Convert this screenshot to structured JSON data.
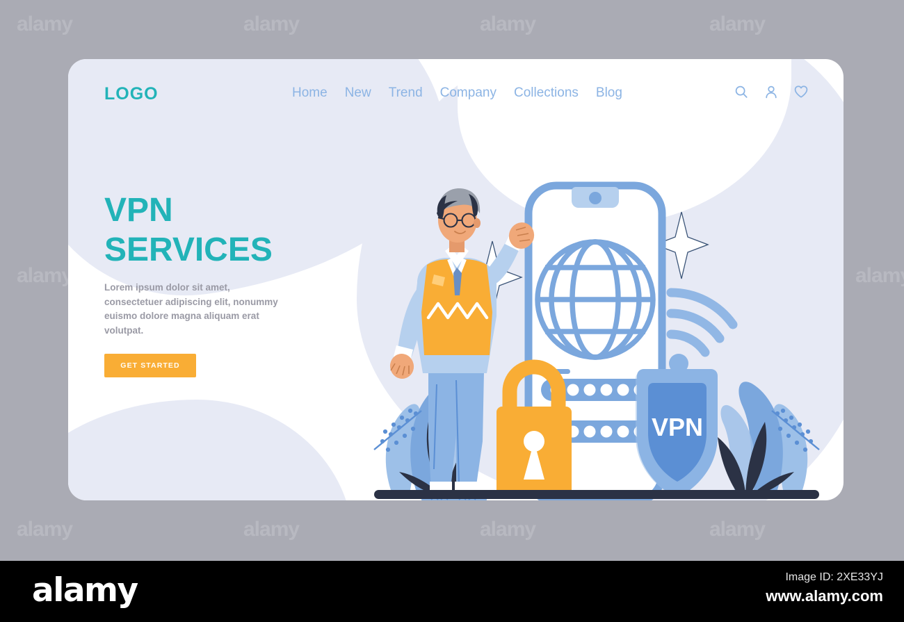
{
  "stock": {
    "watermark_text": "alamy",
    "footer_logo": "alamy",
    "image_id": "Image ID: 2XE33YJ",
    "url": "www.alamy.com"
  },
  "header": {
    "logo": "LOGO",
    "nav": [
      {
        "label": "Home"
      },
      {
        "label": "New"
      },
      {
        "label": "Trend"
      },
      {
        "label": "Company"
      },
      {
        "label": "Collections"
      },
      {
        "label": "Blog"
      }
    ],
    "icons": [
      {
        "name": "search-icon"
      },
      {
        "name": "user-icon"
      },
      {
        "name": "heart-icon"
      }
    ]
  },
  "hero": {
    "title_line1": "VPN",
    "title_line2": "SERVICES",
    "paragraph": "Lorem ipsum dolor sit amet, consectetuer adipiscing elit, nonummy euismo dolore magna aliquam erat volutpat.",
    "cta_label": "GET STARTED"
  },
  "illustration": {
    "shield_label": "VPN",
    "server_rows": 2,
    "server_dots_per_row": 6,
    "sparkles": 2,
    "wifi_arcs": 3,
    "character": "man-standing-pointing"
  },
  "colors": {
    "brand_teal": "#22b3b8",
    "nav_blue": "#8cb4e4",
    "cta_orange": "#f9ad35",
    "illustration_blue": "#7ba7dd",
    "shield_blue": "#5b8fd4",
    "lavender": "#e7eaf5",
    "dark_navy": "#2b3245",
    "page_background": "#aaabb4"
  }
}
